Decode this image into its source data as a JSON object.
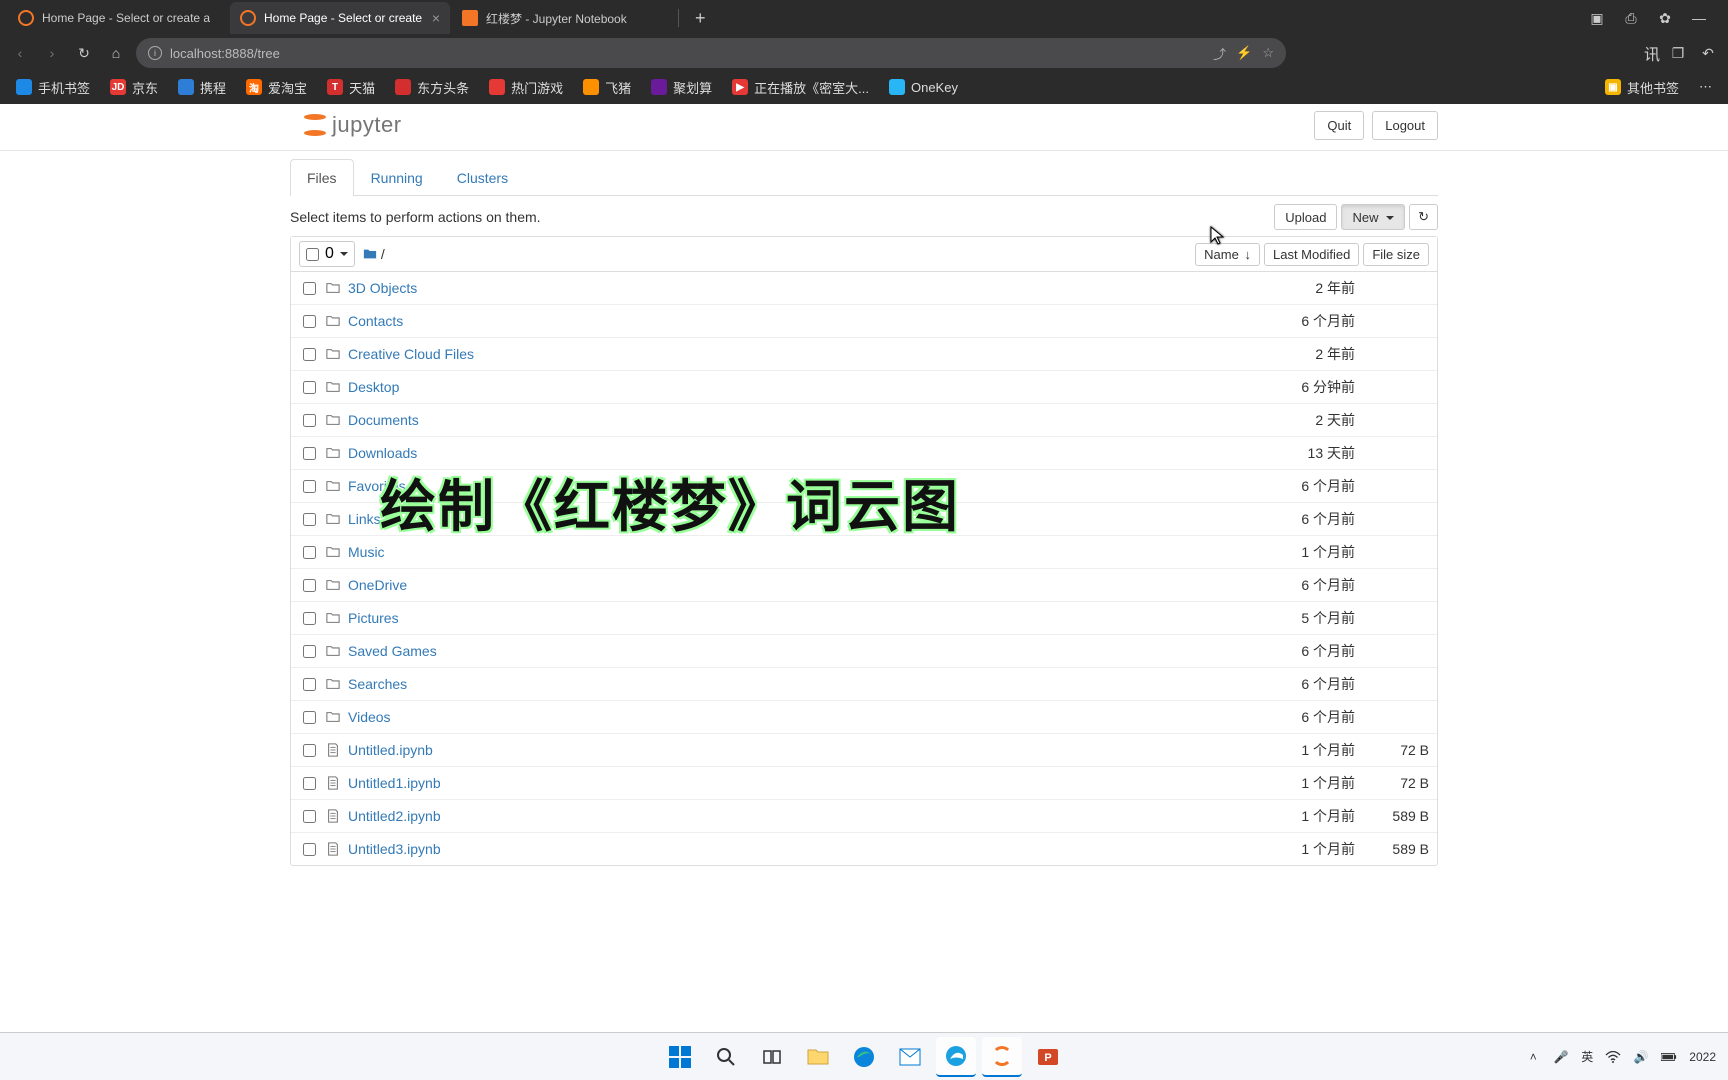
{
  "browser": {
    "tabs": [
      {
        "label": "Home Page - Select or create a",
        "active": false,
        "kind": "jupyter"
      },
      {
        "label": "Home Page - Select or create",
        "active": true,
        "kind": "jupyter"
      },
      {
        "label": "红楼梦 - Jupyter Notebook",
        "active": false,
        "kind": "notebook"
      }
    ],
    "url": "localhost:8888/tree",
    "bookmarks": [
      {
        "label": "手机书签",
        "color": "#1e88e5"
      },
      {
        "label": "京东",
        "color": "#e53935",
        "badge": "JD"
      },
      {
        "label": "携程",
        "color": "#2e7dd7"
      },
      {
        "label": "爱淘宝",
        "color": "#ff6a00",
        "badge": "淘"
      },
      {
        "label": "天猫",
        "color": "#d32f2f",
        "badge": "T"
      },
      {
        "label": "东方头条",
        "color": "#d32f2f"
      },
      {
        "label": "热门游戏",
        "color": "#e53935"
      },
      {
        "label": "飞猪",
        "color": "#ff9100"
      },
      {
        "label": "聚划算",
        "color": "#6a1b9a"
      },
      {
        "label": "正在播放《密室大...",
        "color": "#e53935",
        "badge": "▶"
      },
      {
        "label": "OneKey",
        "color": "#29b6f6"
      }
    ],
    "bookmark_other": "其他书签"
  },
  "jupyter": {
    "logo_text": "jupyter",
    "buttons": {
      "quit": "Quit",
      "logout": "Logout"
    },
    "tabs": {
      "files": "Files",
      "running": "Running",
      "clusters": "Clusters"
    },
    "hint": "Select items to perform actions on them.",
    "toolbar": {
      "upload": "Upload",
      "new": "New"
    },
    "select_count": "0",
    "breadcrumb_sep": "/",
    "columns": {
      "name": "Name",
      "last_modified": "Last Modified",
      "file_size": "File size"
    },
    "items": [
      {
        "name": "3D Objects",
        "type": "dir",
        "modified": "2 年前",
        "size": ""
      },
      {
        "name": "Contacts",
        "type": "dir",
        "modified": "6 个月前",
        "size": ""
      },
      {
        "name": "Creative Cloud Files",
        "type": "dir",
        "modified": "2 年前",
        "size": ""
      },
      {
        "name": "Desktop",
        "type": "dir",
        "modified": "6 分钟前",
        "size": ""
      },
      {
        "name": "Documents",
        "type": "dir",
        "modified": "2 天前",
        "size": ""
      },
      {
        "name": "Downloads",
        "type": "dir",
        "modified": "13 天前",
        "size": ""
      },
      {
        "name": "Favorites",
        "type": "dir",
        "modified": "6 个月前",
        "size": ""
      },
      {
        "name": "Links",
        "type": "dir",
        "modified": "6 个月前",
        "size": ""
      },
      {
        "name": "Music",
        "type": "dir",
        "modified": "1 个月前",
        "size": ""
      },
      {
        "name": "OneDrive",
        "type": "dir",
        "modified": "6 个月前",
        "size": ""
      },
      {
        "name": "Pictures",
        "type": "dir",
        "modified": "5 个月前",
        "size": ""
      },
      {
        "name": "Saved Games",
        "type": "dir",
        "modified": "6 个月前",
        "size": ""
      },
      {
        "name": "Searches",
        "type": "dir",
        "modified": "6 个月前",
        "size": ""
      },
      {
        "name": "Videos",
        "type": "dir",
        "modified": "6 个月前",
        "size": ""
      },
      {
        "name": "Untitled.ipynb",
        "type": "file",
        "modified": "1 个月前",
        "size": "72 B"
      },
      {
        "name": "Untitled1.ipynb",
        "type": "file",
        "modified": "1 个月前",
        "size": "72 B"
      },
      {
        "name": "Untitled2.ipynb",
        "type": "file",
        "modified": "1 个月前",
        "size": "589 B"
      },
      {
        "name": "Untitled3.ipynb",
        "type": "file",
        "modified": "1 个月前",
        "size": "589 B"
      }
    ]
  },
  "overlay": "绘制《红楼梦》词云图",
  "taskbar": {
    "ime": "英",
    "clock_year": "2022"
  }
}
